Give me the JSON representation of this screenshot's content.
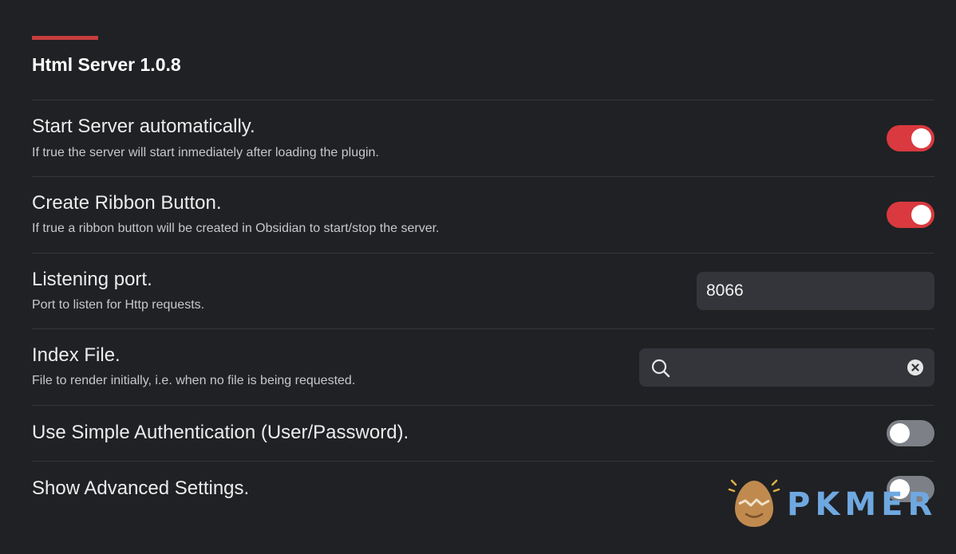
{
  "plugin": {
    "title": "Html Server 1.0.8"
  },
  "settings": [
    {
      "name": "Start Server automatically.",
      "description": "If true the server will start inmediately after loading the plugin.",
      "control": "toggle",
      "enabled": true
    },
    {
      "name": "Create Ribbon Button.",
      "description": "If true a ribbon button will be created in Obsidian to start/stop the server.",
      "control": "toggle",
      "enabled": true
    },
    {
      "name": "Listening port.",
      "description": "Port to listen for Http requests.",
      "control": "text",
      "value": "8066"
    },
    {
      "name": "Index File.",
      "description": "File to render initially, i.e. when no file is being requested.",
      "control": "search",
      "value": ""
    },
    {
      "name": "Use Simple Authentication (User/Password).",
      "control": "toggle",
      "enabled": false
    },
    {
      "name": "Show Advanced Settings.",
      "control": "toggle",
      "enabled": false
    }
  ],
  "icons": {
    "search": "search-icon",
    "clear": "clear-icon"
  },
  "colors": {
    "accent": "#c63d3d",
    "toggle_on": "#d9393f",
    "toggle_off": "#7d8187",
    "background": "#202124"
  },
  "watermark": {
    "text": "PKMER"
  }
}
